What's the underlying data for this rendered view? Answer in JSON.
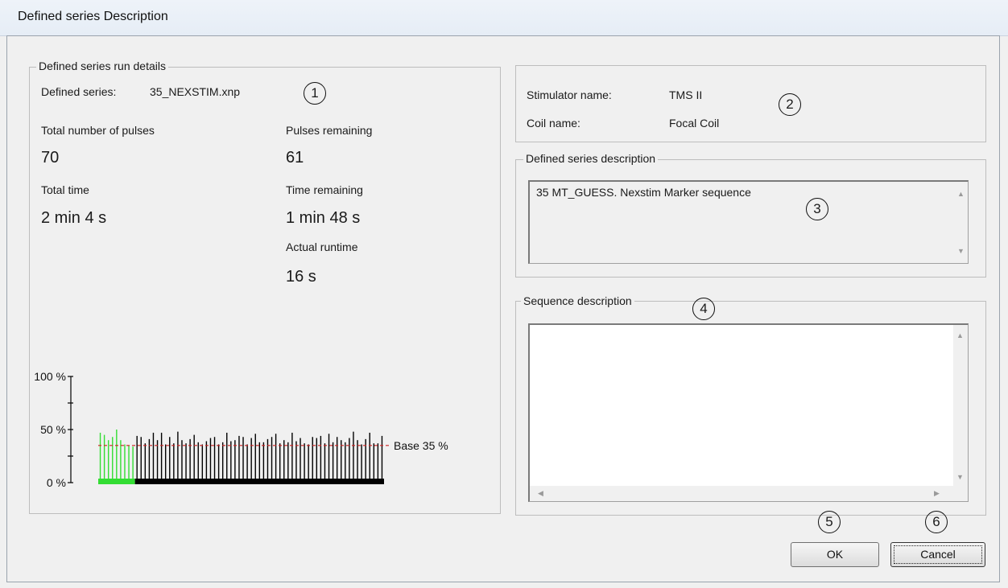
{
  "window": {
    "title": "Defined series Description"
  },
  "run_details": {
    "legend": "Defined series run details",
    "defined_series_label": "Defined series:",
    "defined_series_value": "35_NEXSTIM.xnp",
    "total_pulses_label": "Total number of pulses",
    "total_pulses_value": "70",
    "pulses_remaining_label": "Pulses remaining",
    "pulses_remaining_value": "61",
    "total_time_label": "Total time",
    "total_time_value": "2 min 4 s",
    "time_remaining_label": "Time remaining",
    "time_remaining_value": "1 min 48 s",
    "actual_runtime_label": "Actual runtime",
    "actual_runtime_value": "16 s"
  },
  "stimulator": {
    "stimulator_name_label": "Stimulator name:",
    "stimulator_name_value": "TMS II",
    "coil_name_label": "Coil name:",
    "coil_name_value": "Focal Coil"
  },
  "series_description": {
    "legend": "Defined series description",
    "text": "35 MT_GUESS. Nexstim Marker sequence"
  },
  "sequence_description": {
    "legend": "Sequence description",
    "text": ""
  },
  "callouts": [
    "1",
    "2",
    "3",
    "4",
    "5",
    "6"
  ],
  "buttons": {
    "ok": "OK",
    "cancel": "Cancel"
  },
  "chart_data": {
    "type": "bar",
    "tick_labels": [
      "100 %",
      "50 %",
      "0 %"
    ],
    "ylim": [
      0,
      100
    ],
    "base_label": "Base 35 %",
    "base_value": 35,
    "total_pulses": 70,
    "delivered_pulses": 9,
    "colors": {
      "delivered": "#33dd33",
      "pending": "#000000",
      "base_line": "#cc2222"
    },
    "values": [
      47,
      45,
      40,
      43,
      50,
      40,
      36,
      35,
      34,
      44,
      43,
      37,
      41,
      47,
      40,
      47,
      36,
      43,
      37,
      48,
      40,
      37,
      41,
      45,
      38,
      36,
      39,
      42,
      43,
      36,
      38,
      47,
      39,
      40,
      44,
      43,
      36,
      42,
      46,
      38,
      38,
      41,
      43,
      46,
      37,
      40,
      38,
      47,
      39,
      42,
      37,
      36,
      43,
      42,
      44,
      37,
      46,
      38,
      43,
      40,
      38,
      42,
      48,
      40,
      36,
      41,
      47,
      37,
      37,
      44
    ]
  }
}
